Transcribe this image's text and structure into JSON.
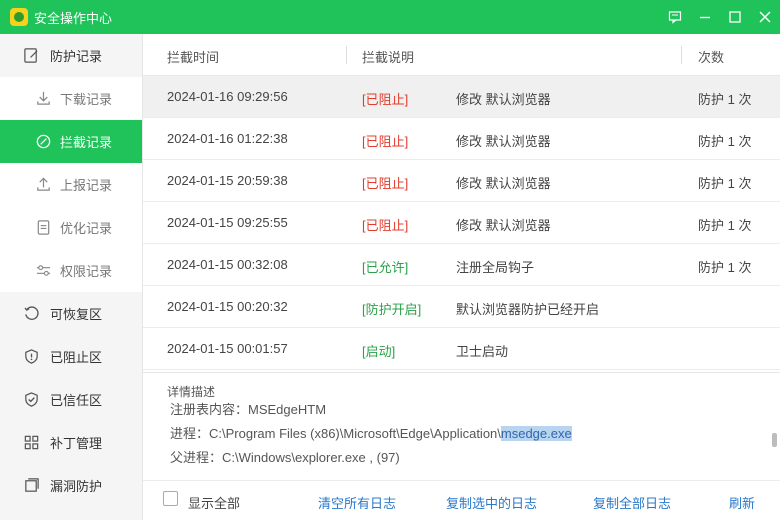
{
  "window": {
    "title": "安全操作中心",
    "accent": "#1fc35a"
  },
  "sidebar": {
    "items": [
      {
        "label": "防护记录",
        "icon": "edit-doc-icon"
      },
      {
        "label": "下载记录",
        "icon": "download-icon"
      },
      {
        "label": "拦截记录",
        "icon": "blocked-circle-icon",
        "active": true
      },
      {
        "label": "上报记录",
        "icon": "upload-icon"
      },
      {
        "label": "优化记录",
        "icon": "document-icon"
      },
      {
        "label": "权限记录",
        "icon": "sliders-icon"
      },
      {
        "label": "可恢复区",
        "icon": "restore-icon"
      },
      {
        "label": "已阻止区",
        "icon": "shield-alert-icon"
      },
      {
        "label": "已信任区",
        "icon": "shield-check-icon"
      },
      {
        "label": "补丁管理",
        "icon": "grid-icon"
      },
      {
        "label": "漏洞防护",
        "icon": "layers-icon"
      }
    ]
  },
  "table": {
    "headers": {
      "time": "拦截时间",
      "desc": "拦截说明",
      "count": "次数"
    },
    "rows": [
      {
        "time": "2024-01-16 09:29:56",
        "tag": "[已阻止]",
        "tag_color": "red",
        "desc": "修改 默认浏览器",
        "count": "防护 1 次"
      },
      {
        "time": "2024-01-16 01:22:38",
        "tag": "[已阻止]",
        "tag_color": "red",
        "desc": "修改 默认浏览器",
        "count": "防护 1 次"
      },
      {
        "time": "2024-01-15 20:59:38",
        "tag": "[已阻止]",
        "tag_color": "red",
        "desc": "修改 默认浏览器",
        "count": "防护 1 次"
      },
      {
        "time": "2024-01-15 09:25:55",
        "tag": "[已阻止]",
        "tag_color": "red",
        "desc": "修改 默认浏览器",
        "count": "防护 1 次"
      },
      {
        "time": "2024-01-15 00:32:08",
        "tag": "[已允许]",
        "tag_color": "green",
        "desc": "注册全局钩子",
        "count": "防护 1 次"
      },
      {
        "time": "2024-01-15 00:20:32",
        "tag": "[防护开启]",
        "tag_color": "green",
        "desc": "默认浏览器防护已经开启",
        "count": ""
      },
      {
        "time": "2024-01-15 00:01:57",
        "tag": "[启动]",
        "tag_color": "green",
        "desc": "卫士启动",
        "count": ""
      }
    ]
  },
  "detail": {
    "title": "详情描述",
    "line0": "注册表内容：MSEdgeHTM",
    "line1_prefix": "进程：C:\\Program Files (x86)\\Microsoft\\Edge\\Application\\",
    "line1_highlight": "msedge.exe",
    "line2": "父进程：C:\\Windows\\explorer.exe , (97)"
  },
  "footer": {
    "show_all": "显示全部",
    "clear_logs": "清空所有日志",
    "copy_selected": "复制选中的日志",
    "copy_all": "复制全部日志",
    "refresh": "刷新"
  }
}
